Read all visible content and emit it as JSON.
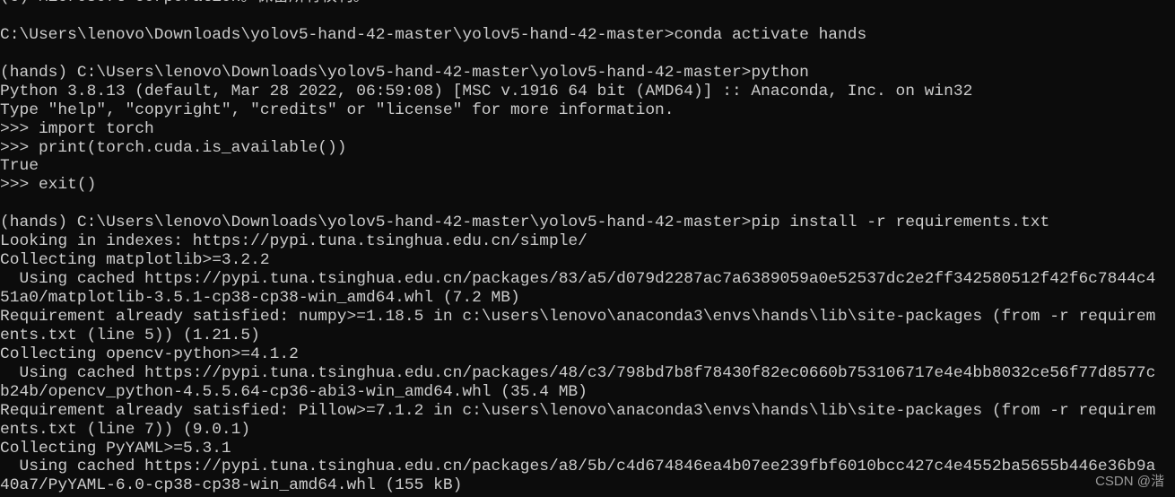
{
  "terminal": {
    "background": "#0c0c0c",
    "foreground": "#cccccc",
    "lines": [
      "(c) Microsoft Corporation。保留所有权利。",
      "",
      "C:\\Users\\lenovo\\Downloads\\yolov5-hand-42-master\\yolov5-hand-42-master>conda activate hands",
      "",
      "(hands) C:\\Users\\lenovo\\Downloads\\yolov5-hand-42-master\\yolov5-hand-42-master>python",
      "Python 3.8.13 (default, Mar 28 2022, 06:59:08) [MSC v.1916 64 bit (AMD64)] :: Anaconda, Inc. on win32",
      "Type \"help\", \"copyright\", \"credits\" or \"license\" for more information.",
      ">>> import torch",
      ">>> print(torch.cuda.is_available())",
      "True",
      ">>> exit()",
      "",
      "(hands) C:\\Users\\lenovo\\Downloads\\yolov5-hand-42-master\\yolov5-hand-42-master>pip install -r requirements.txt",
      "Looking in indexes: https://pypi.tuna.tsinghua.edu.cn/simple/",
      "Collecting matplotlib>=3.2.2",
      "  Using cached https://pypi.tuna.tsinghua.edu.cn/packages/83/a5/d079d2287ac7a6389059a0e52537dc2e2ff342580512f42f6c7844c4",
      "51a0/matplotlib-3.5.1-cp38-cp38-win_amd64.whl (7.2 MB)",
      "Requirement already satisfied: numpy>=1.18.5 in c:\\users\\lenovo\\anaconda3\\envs\\hands\\lib\\site-packages (from -r requirem",
      "ents.txt (line 5)) (1.21.5)",
      "Collecting opencv-python>=4.1.2",
      "  Using cached https://pypi.tuna.tsinghua.edu.cn/packages/48/c3/798bd7b8f78430f82ec0660b753106717e4e4bb8032ce56f77d8577c",
      "b24b/opencv_python-4.5.5.64-cp36-abi3-win_amd64.whl (35.4 MB)",
      "Requirement already satisfied: Pillow>=7.1.2 in c:\\users\\lenovo\\anaconda3\\envs\\hands\\lib\\site-packages (from -r requirem",
      "ents.txt (line 7)) (9.0.1)",
      "Collecting PyYAML>=5.3.1",
      "  Using cached https://pypi.tuna.tsinghua.edu.cn/packages/a8/5b/c4d674846ea4b07ee239fbf6010bcc427c4e4552ba5655b446e36b9a",
      "40a7/PyYAML-6.0-cp38-cp38-win_amd64.whl (155 kB)"
    ]
  },
  "watermark": "CSDN @湝"
}
